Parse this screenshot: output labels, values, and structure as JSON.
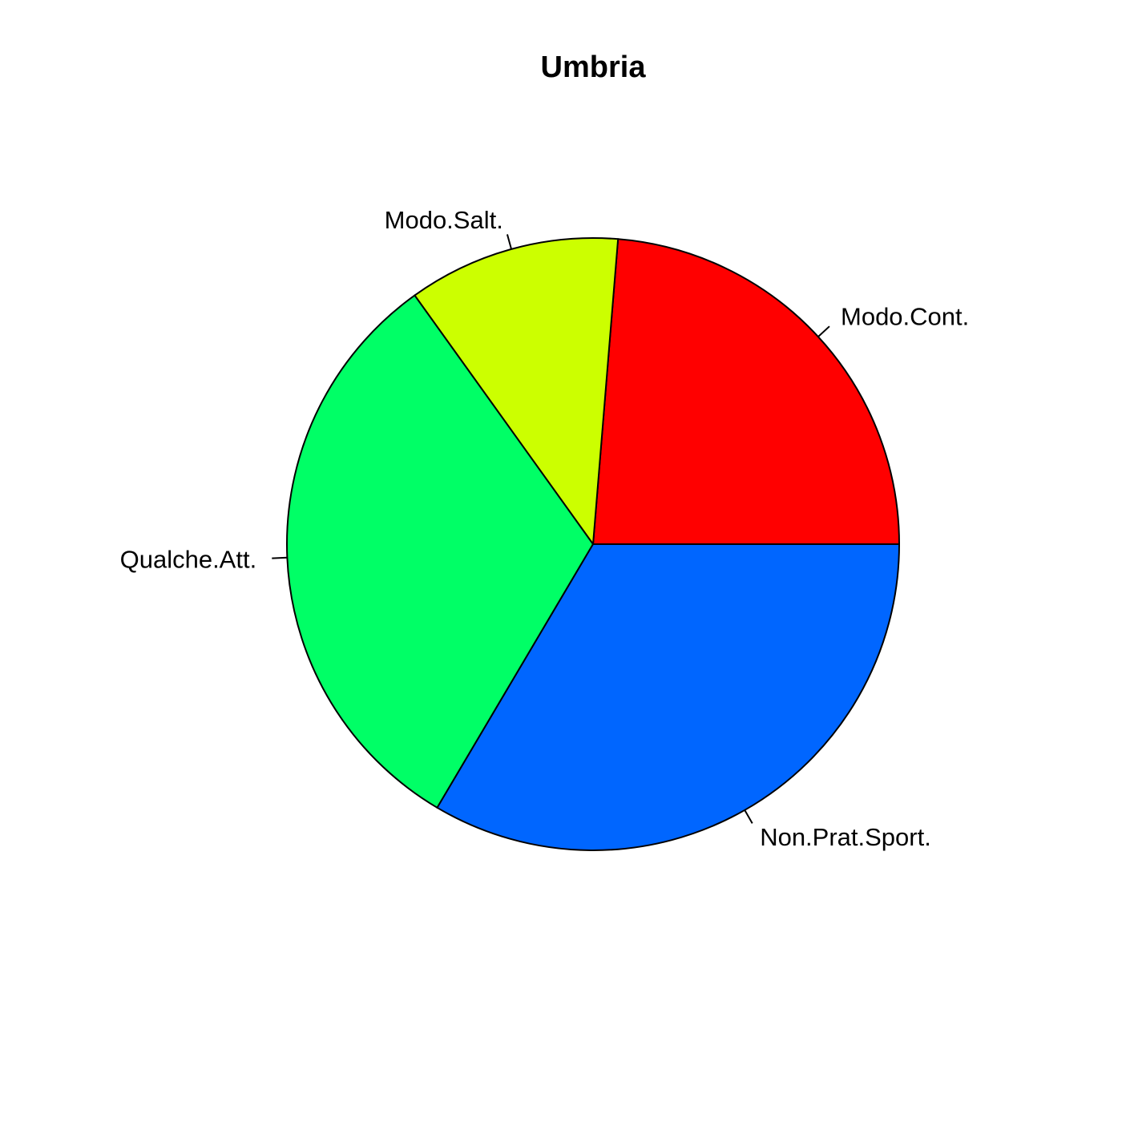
{
  "chart_data": {
    "type": "pie",
    "title": "Umbria",
    "start_angle_deg": 0,
    "direction": "counterclockwise",
    "slices": [
      {
        "label": "Modo.Cont.",
        "value": 23.7,
        "color": "#FF0000"
      },
      {
        "label": "Modo.Salt.",
        "value": 11.2,
        "color": "#CCFF00"
      },
      {
        "label": "Qualche.Att.",
        "value": 31.6,
        "color": "#00FF66"
      },
      {
        "label": "Non.Prat.Sport.",
        "value": 33.5,
        "color": "#0066FF"
      }
    ]
  }
}
